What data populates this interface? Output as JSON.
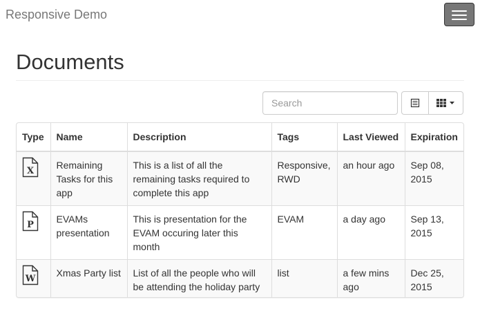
{
  "app": {
    "brand": "Responsive Demo"
  },
  "navbar": {
    "menu_icon": "hamburger-icon"
  },
  "page": {
    "title": "Documents"
  },
  "toolbar": {
    "search_placeholder": "Search",
    "list_view_icon": "list-view-icon",
    "columns_icon": "columns-icon",
    "dropdown_icon": "caret-down-icon"
  },
  "table": {
    "headers": {
      "type": "Type",
      "name": "Name",
      "description": "Description",
      "tags": "Tags",
      "last_viewed": "Last Viewed",
      "expiration": "Expiration"
    },
    "rows": [
      {
        "type_icon": "excel-document-icon",
        "type_letter": "X",
        "name": "Remaining Tasks for this app",
        "description": "This is a list of all the remaining tasks required to complete this app",
        "tags": "Responsive, RWD",
        "last_viewed": "an hour ago",
        "expiration": "Sep 08, 2015"
      },
      {
        "type_icon": "powerpoint-document-icon",
        "type_letter": "P",
        "name": "EVAMs presentation",
        "description": "This is presentation for the EVAM occuring later this month",
        "tags": "EVAM",
        "last_viewed": "a day ago",
        "expiration": "Sep 13, 2015"
      },
      {
        "type_icon": "word-document-icon",
        "type_letter": "W",
        "name": "Xmas Party list",
        "description": "List of all the people who will be attending the holiday party",
        "tags": "list",
        "last_viewed": "a few mins ago",
        "expiration": "Dec 25, 2015"
      }
    ]
  },
  "colors": {
    "brand_text": "#777777",
    "toggle_bg": "#777777",
    "border": "#dddddd",
    "stripe": "#f9f9f9",
    "text": "#333333"
  }
}
